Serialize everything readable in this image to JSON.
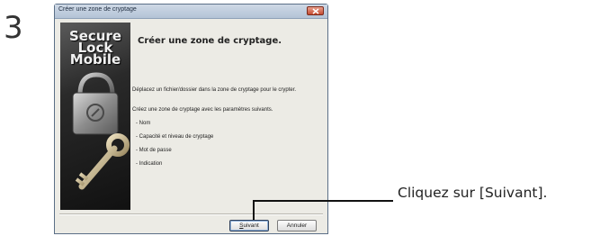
{
  "step": {
    "number": "3"
  },
  "dialog": {
    "title": "Créer une zone de cryptage",
    "banner_lines": [
      "Secure",
      "Lock",
      "Mobile"
    ],
    "heading": "Créer une zone de cryptage.",
    "instruction_1": "Déplacez un fichier/dossier dans la zone de cryptage pour le crypter.",
    "instruction_2": "Créez une zone de cryptage avec les paramètres suivants.",
    "parameters": [
      "- Nom",
      "- Capacité et niveau de cryptage",
      "- Mot de passe",
      "- Indication"
    ],
    "buttons": {
      "next_mnemonic": "S",
      "next_rest": "uivant",
      "cancel": "Annuler"
    }
  },
  "callout": {
    "text": "Cliquez sur [Suivant]."
  },
  "colors": {
    "dialog_bg": "#ecebe5",
    "titlebar": "#c3cfde",
    "close_button": "#c64b30",
    "banner": "#2a2a2a"
  }
}
